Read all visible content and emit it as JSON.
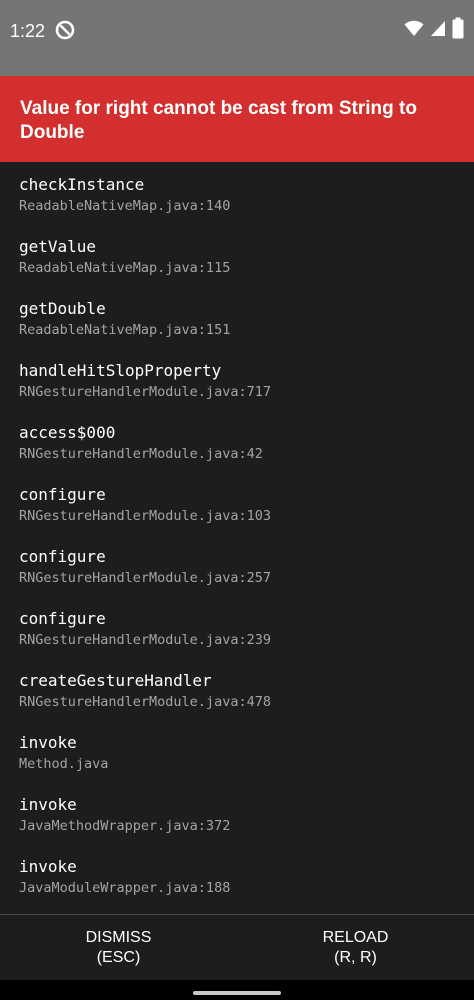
{
  "status_bar": {
    "time": "1:22",
    "icons": [
      "dnd-icon",
      "wifi-icon",
      "cellular-icon",
      "battery-icon"
    ]
  },
  "error": {
    "title": "Value for right cannot be cast from String to Double",
    "color": "#d32f2f"
  },
  "stack": [
    {
      "method": "checkInstance",
      "file": "ReadableNativeMap.java:140"
    },
    {
      "method": "getValue",
      "file": "ReadableNativeMap.java:115"
    },
    {
      "method": "getDouble",
      "file": "ReadableNativeMap.java:151"
    },
    {
      "method": "handleHitSlopProperty",
      "file": "RNGestureHandlerModule.java:717"
    },
    {
      "method": "access$000",
      "file": "RNGestureHandlerModule.java:42"
    },
    {
      "method": "configure",
      "file": "RNGestureHandlerModule.java:103"
    },
    {
      "method": "configure",
      "file": "RNGestureHandlerModule.java:257"
    },
    {
      "method": "configure",
      "file": "RNGestureHandlerModule.java:239"
    },
    {
      "method": "createGestureHandler",
      "file": "RNGestureHandlerModule.java:478"
    },
    {
      "method": "invoke",
      "file": "Method.java"
    },
    {
      "method": "invoke",
      "file": "JavaMethodWrapper.java:372"
    },
    {
      "method": "invoke",
      "file": "JavaModuleWrapper.java:188"
    }
  ],
  "buttons": {
    "dismiss": {
      "label": "DISMISS",
      "shortcut": "(ESC)"
    },
    "reload": {
      "label": "RELOAD",
      "shortcut": "(R, R)"
    }
  }
}
